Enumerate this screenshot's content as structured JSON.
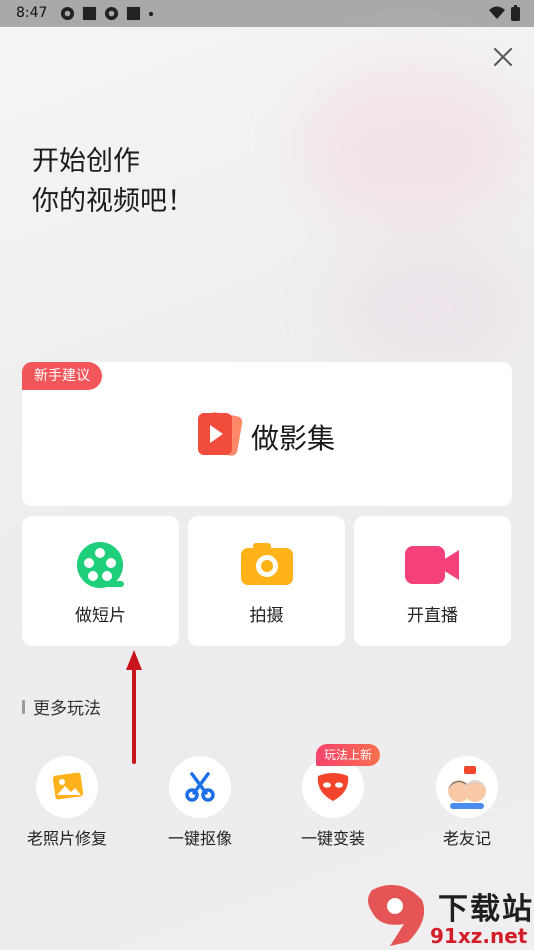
{
  "status_bar": {
    "time": "8:47"
  },
  "headline": {
    "line1": "开始创作",
    "line2": "你的视频吧！"
  },
  "featured": {
    "badge": "新手建议",
    "label": "做影集"
  },
  "tiles": [
    {
      "label": "做短片",
      "icon": "film-reel-icon",
      "color": "#1fcf7a"
    },
    {
      "label": "拍摄",
      "icon": "camera-icon",
      "color": "#ffb319"
    },
    {
      "label": "开直播",
      "icon": "video-camera-icon",
      "color": "#f4417a"
    }
  ],
  "section": {
    "title": "更多玩法"
  },
  "more": [
    {
      "label": "老照片修复",
      "icon": "photo-restore-icon"
    },
    {
      "label": "一键抠像",
      "icon": "scissors-icon"
    },
    {
      "label": "一键变装",
      "icon": "mask-icon",
      "badge": "玩法上新"
    },
    {
      "label": "老友记",
      "icon": "elderly-couple-icon"
    }
  ],
  "watermark": {
    "title": "下载站",
    "url": "91xz.net"
  },
  "colors": {
    "accent_red": "#f0565a",
    "arrow": "#c8151b"
  }
}
